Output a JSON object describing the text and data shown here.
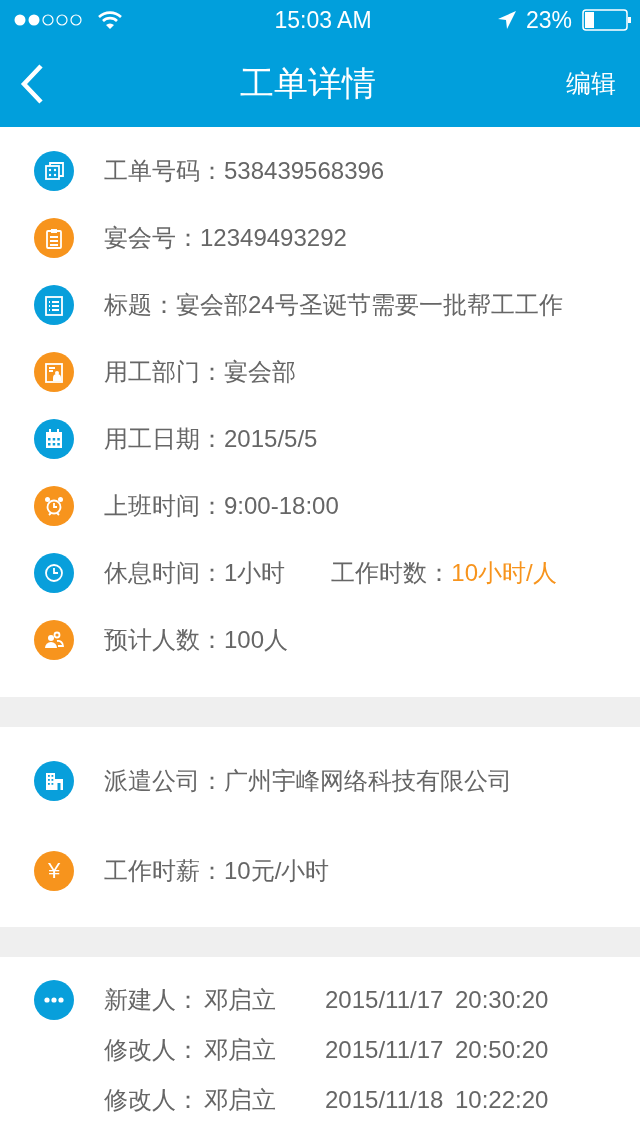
{
  "status_bar": {
    "time": "15:03 AM",
    "battery": "23%"
  },
  "nav": {
    "title": "工单详情",
    "action": "编辑"
  },
  "sections": [
    {
      "rows": [
        {
          "kind": "cards",
          "color": "#089fdb",
          "label": "工单号码：",
          "value": "538439568396"
        },
        {
          "kind": "clipboard",
          "color": "#f7941d",
          "label": "宴会号：",
          "value": "12349493292"
        },
        {
          "kind": "list",
          "color": "#089fdb",
          "label": "标题：",
          "value": "宴会部24号圣诞节需要一批帮工工作"
        },
        {
          "kind": "badge",
          "color": "#f7941d",
          "label": "用工部门：",
          "value": "宴会部"
        },
        {
          "kind": "calendar",
          "color": "#089fdb",
          "label": "用工日期：",
          "value": "2015/5/5"
        },
        {
          "kind": "alarm",
          "color": "#f7941d",
          "label": "上班时间：",
          "value": "9:00-18:00"
        },
        {
          "kind": "clock",
          "color": "#089fdb",
          "label": "休息时间：",
          "value": "1小时",
          "label_2": "工作时数：",
          "value_2": "10小时/人"
        },
        {
          "kind": "people",
          "color": "#f7941d",
          "label": "预计人数：",
          "value": "100人"
        }
      ]
    },
    {
      "rows": [
        {
          "kind": "building",
          "color": "#089fdb",
          "label": "派遣公司：",
          "value": "广州宇峰网络科技有限公司"
        },
        {
          "kind": "yen",
          "color": "#f7941d",
          "icon_text": "¥",
          "label": "工作时薪：",
          "value": "10元/小时"
        }
      ]
    }
  ],
  "history": {
    "entries": [
      {
        "label": "新建人：",
        "name": "邓启立",
        "date": "2015/11/17",
        "time": "20:30:20"
      },
      {
        "label": "修改人：",
        "name": "邓启立",
        "date": "2015/11/17",
        "time": "20:50:20"
      },
      {
        "label": "修改人：",
        "name": "邓启立",
        "date": "2015/11/18",
        "time": "10:22:20"
      }
    ]
  }
}
